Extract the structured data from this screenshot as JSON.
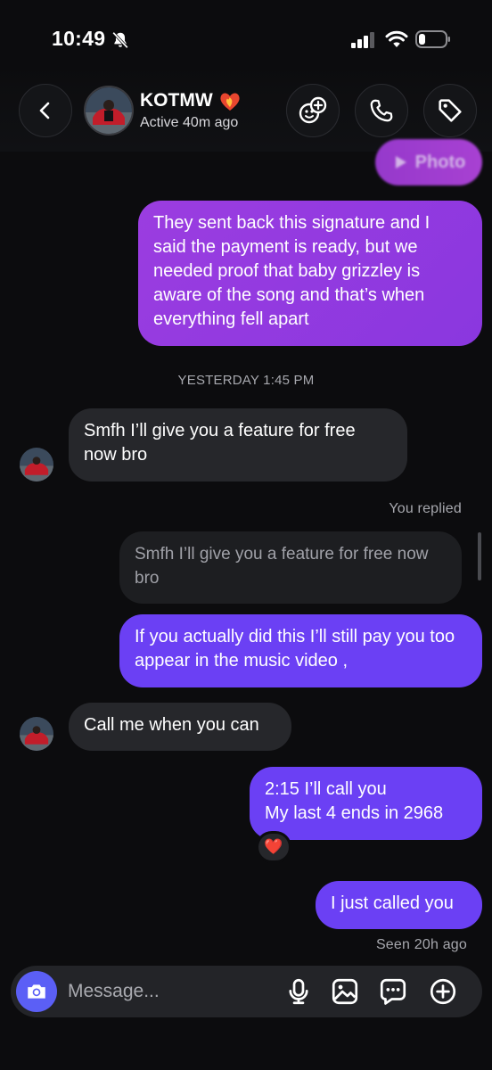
{
  "status_bar": {
    "time": "10:49"
  },
  "header": {
    "contact_name": "KOTMW",
    "contact_status": "Active 40m ago"
  },
  "photo_preview": {
    "label": "Photo"
  },
  "messages": [
    {
      "side": "mine",
      "text": "They sent back this signature and I said the payment is ready, but we needed proof that baby grizzley is aware of the song and that’s when everything fell apart"
    },
    {
      "type": "timestamp",
      "text": "YESTERDAY 1:45 PM"
    },
    {
      "side": "theirs",
      "text": "Smfh I’ll give you a feature for free now bro"
    },
    {
      "side": "mine",
      "reply_label": "You replied",
      "quoted_text": "Smfh I’ll give you a feature for free now bro",
      "text": "If you actually did this I’ll still pay you too appear in the music video ,"
    },
    {
      "side": "theirs",
      "text": "Call me when you can"
    },
    {
      "side": "mine",
      "text": "2:15 I’ll call you\nMy last 4 ends in 2968",
      "reaction": "❤️"
    },
    {
      "side": "mine",
      "text": "I just called you",
      "receipt": "Seen 20h ago"
    }
  ],
  "composer": {
    "placeholder": "Message..."
  },
  "colors": {
    "background": "#0c0c0e",
    "bubble_theirs": "#26272b",
    "bubble_mine_purple": "#9b3de0",
    "bubble_mine_violet": "#6b40f4",
    "camera_button": "#5b5ff6"
  },
  "icons": [
    "bell-slash-icon",
    "signal-icon",
    "wifi-icon",
    "battery-icon",
    "back-chevron-icon",
    "add-people-icon",
    "phone-icon",
    "tag-icon",
    "camera-icon",
    "microphone-icon",
    "gallery-icon",
    "sticker-icon",
    "plus-icon",
    "play-icon",
    "heart-reaction"
  ]
}
